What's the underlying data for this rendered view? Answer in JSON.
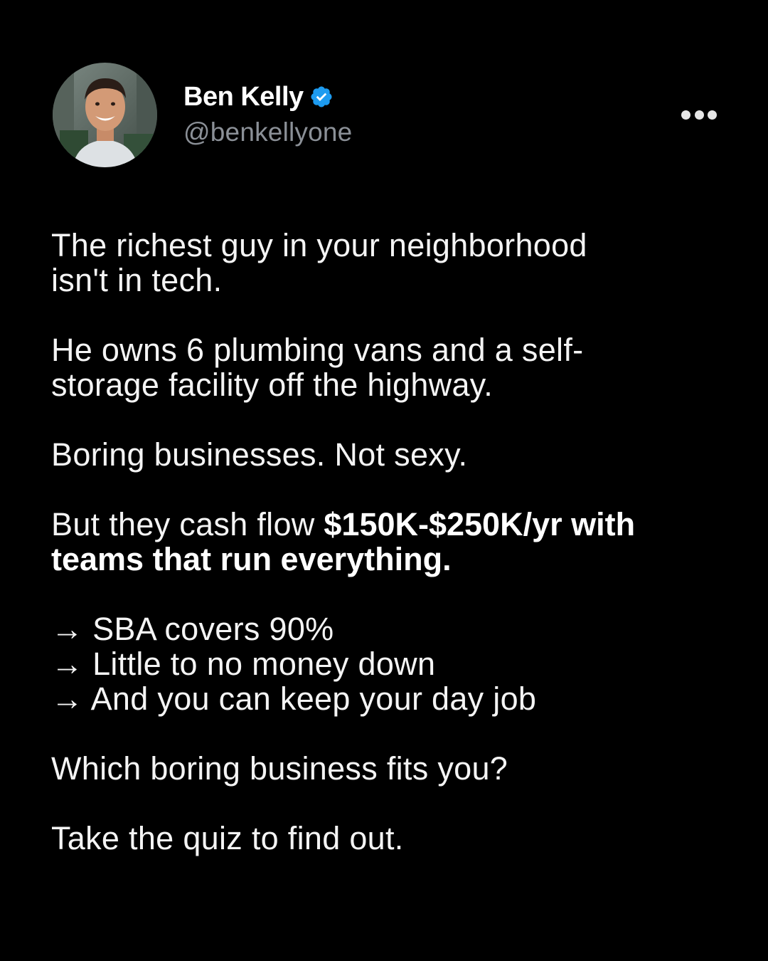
{
  "author": {
    "name": "Ben Kelly",
    "handle": "@benkellyone",
    "verified_color": "#1d9bf0"
  },
  "icons": {
    "verified": "verified-badge-icon",
    "more": "more-options-icon"
  },
  "post": {
    "line1a": "The richest guy in your neighborhood",
    "line1b": "isn't in tech.",
    "line2a": "He owns 6 plumbing vans and a self-",
    "line2b": "storage facility off the highway.",
    "line3": "Boring businesses. Not sexy.",
    "line4_normal": "But they cash flow ",
    "line4_bold_a": "$150K-$250K/yr with",
    "line4_bold_b": "teams that run everything.",
    "bullets": [
      "→ SBA covers 90%",
      "→ Little to no money down",
      "→ And you can keep your day job"
    ],
    "question": "Which boring business fits you?",
    "cta": "Take the quiz to find out."
  },
  "colors": {
    "background": "#000000",
    "text": "#ffffff",
    "handle": "#8b9097"
  }
}
